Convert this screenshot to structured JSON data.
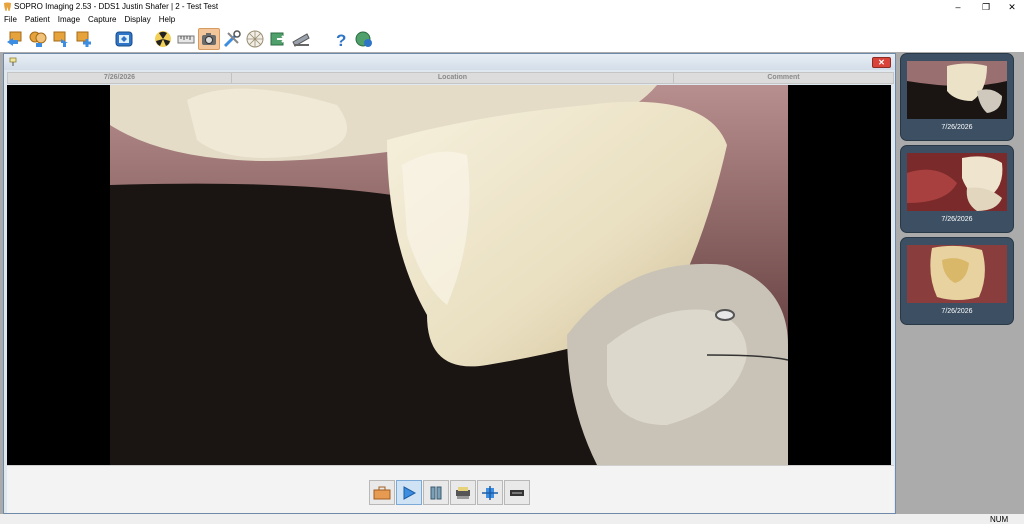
{
  "window": {
    "title": "SOPRO Imaging 2.53 - DDS1 Justin Shafer | 2 - Test Test",
    "minimize": "–",
    "maximize": "❐",
    "close": "✕"
  },
  "menu": [
    "File",
    "Patient",
    "Image",
    "Capture",
    "Display",
    "Help"
  ],
  "toolbar": {
    "icons": [
      "arrow-left-icon",
      "patients-icon",
      "import-icon",
      "add-patient-icon",
      "tablet-icon",
      "xray-icon",
      "ruler-icon",
      "camera-icon",
      "tools-icon",
      "teeth-chart-icon",
      "export-icon",
      "scanner-icon",
      "help-icon",
      "update-icon"
    ],
    "active": "camera-icon"
  },
  "viewer": {
    "columns": [
      "7/26/2026",
      "Location",
      "Comment"
    ],
    "close_label": "✕"
  },
  "bottom_controls": {
    "icons": [
      "toolbox-icon",
      "play-icon",
      "columns-icon",
      "scanner-icon",
      "adjust-icon",
      "battery-icon"
    ],
    "active": "play-icon"
  },
  "thumbnails": [
    {
      "date": "7/26/2026"
    },
    {
      "date": "7/26/2026"
    },
    {
      "date": "7/26/2026"
    }
  ],
  "status": {
    "num": "NUM"
  },
  "colors": {
    "accent": "#f2c69a",
    "panel": "#3c4f63",
    "frame": "#6e8aa8"
  }
}
